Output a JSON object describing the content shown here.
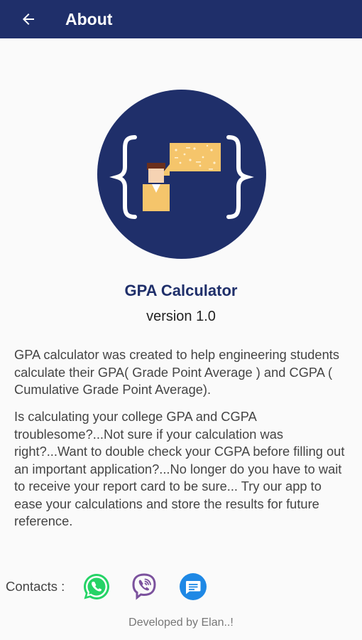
{
  "appbar": {
    "title": "About",
    "back_icon": "arrow-left-icon"
  },
  "logo": {
    "icon": "app-logo-icon",
    "colors": {
      "background": "#1f2f6a",
      "person": "#f5c56b",
      "bubble": "#f5c56b"
    }
  },
  "app": {
    "name": "GPA Calculator",
    "version": "version 1.0"
  },
  "description": {
    "paragraph1": "GPA calculator was created to help engineering students calculate their GPA( Grade Point Average ) and CGPA ( Cumulative Grade Point Average).",
    "paragraph2": "Is calculating your college GPA and CGPA troublesome?...Not sure if your  calculation was right?...Want to double check your CGPA before filling out an important application?...No longer do you have to wait to receive your report card to be sure... Try our app to ease your calculations  and store the results for future reference."
  },
  "contacts": {
    "label": "Contacts :",
    "items": [
      {
        "icon": "whatsapp-icon",
        "color": "#25d366"
      },
      {
        "icon": "viber-icon",
        "color": "#7b519d"
      },
      {
        "icon": "message-icon",
        "color": "#1e88e5"
      }
    ]
  },
  "footer": {
    "text": "Developed by Elan..!"
  },
  "colors": {
    "appbar": "#1f2f6a",
    "title_text": "#1f2f6a"
  }
}
